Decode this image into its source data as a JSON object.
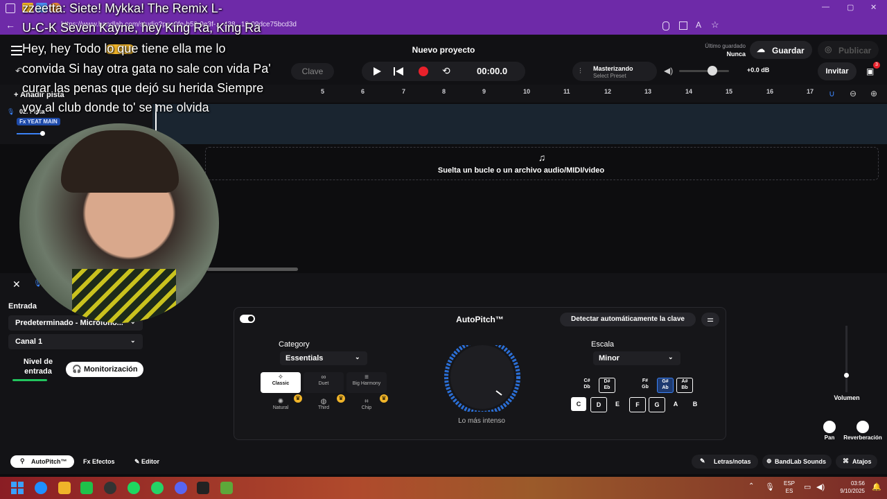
{
  "browser": {
    "tab_title": "zzeetta",
    "url": "https://www.bandlab.com/studio?p=a0fe-b53-9e3f-...-438...19-09dce75bcd3d"
  },
  "lyrics": {
    "lines": [
      "zzeetta: Siete! Mykka! The Remix L-",
      "U-C-K Seven Kayne, hey King Ra, King Ra",
      "Hey, hey Todo lo que tiene ella me lo",
      "convida Si hay otra gata no sale con vida Pa'",
      "curar las penas que dejó su herida Siempre",
      "voy al club donde to' se me olvida"
    ]
  },
  "header": {
    "project_title": "Nuevo proyecto",
    "last_saved_label": "Último guardado",
    "last_saved_value": "Nunca",
    "save_label": "Guardar",
    "publish_label": "Publicar"
  },
  "transport": {
    "key_label": "Clave",
    "time": "00:00.0",
    "mastering_label": "Masterizando",
    "mastering_sub": "Select Preset",
    "volume_db": "+0.0 dB",
    "invite_label": "Invitar",
    "notification_count": "3"
  },
  "timeline": {
    "add_track": "Añadir pista",
    "ruler": [
      "5",
      "6",
      "7",
      "8",
      "9",
      "10",
      "11",
      "12",
      "13",
      "14",
      "15",
      "16",
      "17"
    ]
  },
  "track": {
    "name": "02. Pista",
    "fx_badge": "Fx YEAT MAIN"
  },
  "drop_zone": {
    "text": "Suelta un bucle o un archivo audio/MIDI/video"
  },
  "input_panel": {
    "input_label": "Entrada",
    "device": "Predeterminado - Micrófono...",
    "channel": "Canal 1",
    "level_label": "Nivel de entrada",
    "monitor_label": "Monitorización"
  },
  "autopitch": {
    "title": "AutoPitch™",
    "detect_key": "Detectar automáticamente la clave",
    "category_label": "Category",
    "category_value": "Essentials",
    "presets": [
      "Classic",
      "Duet",
      "Big Harmony",
      "Natural",
      "Third",
      "Chip"
    ],
    "knob_label": "Lo más intenso",
    "scale_label": "Escala",
    "scale_value": "Minor",
    "sharps": [
      "C#\nDb",
      "D#\nEb",
      "F#\nGb",
      "G#\nAb",
      "A#\nBb"
    ],
    "naturals": [
      "C",
      "D",
      "E",
      "F",
      "G",
      "A",
      "B"
    ]
  },
  "mixer": {
    "volume_label": "Volumen",
    "pan_label": "Pan",
    "reverb_label": "Reverberación"
  },
  "bottom_tabs": {
    "autopitch": "AutoPitch™",
    "effects": "Efectos",
    "editor": "Editor",
    "lyrics": "Letras/notas",
    "sounds": "BandLab Sounds",
    "shortcuts": "Atajos"
  },
  "taskbar": {
    "lang_top": "ESP",
    "lang_bottom": "ES",
    "time": "03:56",
    "date": "9/10/2025"
  },
  "colors": {
    "browser_purple": "#6e2aa8",
    "record_red": "#e8212b",
    "accent_blue": "#3b82f6"
  }
}
